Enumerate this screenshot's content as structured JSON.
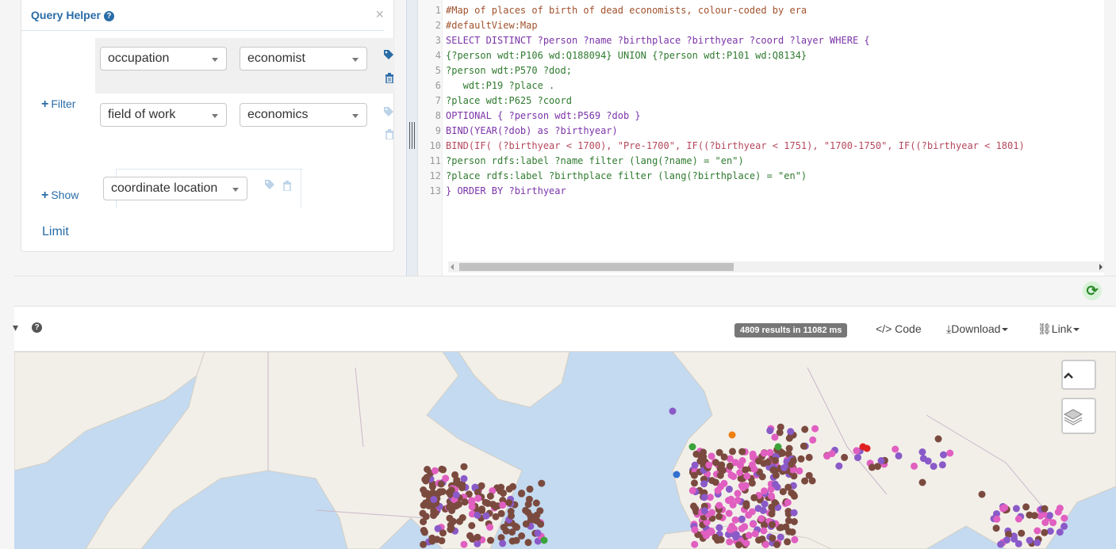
{
  "query_helper": {
    "title": "Query Helper",
    "help_icon": "question-circle-icon",
    "close_label": "×",
    "filter_label": "Filter",
    "show_label": "Show",
    "limit_label": "Limit",
    "filters": [
      {
        "property": "occupation",
        "value": "economist"
      },
      {
        "property": "field of work",
        "value": "economics"
      }
    ],
    "show": {
      "property": "coordinate location"
    }
  },
  "editor": {
    "lines": [
      {
        "n": "1",
        "text": "#Map of places of birth of dead economists, colour-coded by era",
        "kind": "comment"
      },
      {
        "n": "2",
        "text": "#defaultView:Map",
        "kind": "comment"
      },
      {
        "n": "3",
        "text": "SELECT DISTINCT ?person ?name ?birthplace ?birthyear ?coord ?layer WHERE {",
        "kind": "key"
      },
      {
        "n": "4",
        "text": "{?person wdt:P106 wd:Q188094} UNION {?person wdt:P101 wd:Q8134}",
        "kind": "var"
      },
      {
        "n": "5",
        "text": "?person wdt:P570 ?dod;",
        "kind": "var"
      },
      {
        "n": "6",
        "text": "   wdt:P19 ?place .",
        "kind": "var"
      },
      {
        "n": "7",
        "text": "?place wdt:P625 ?coord",
        "kind": "var"
      },
      {
        "n": "8",
        "text": "OPTIONAL { ?person wdt:P569 ?dob }",
        "kind": "key"
      },
      {
        "n": "9",
        "text": "BIND(YEAR(?dob) as ?birthyear)",
        "kind": "key"
      },
      {
        "n": "10",
        "text": "BIND(IF( (?birthyear < 1700), \"Pre-1700\", IF((?birthyear < 1751), \"1700-1750\", IF((?birthyear < 1801)",
        "kind": "code"
      },
      {
        "n": "11",
        "text": "?person rdfs:label ?name filter (lang(?name) = \"en\")",
        "kind": "var"
      },
      {
        "n": "12",
        "text": "?place rdfs:label ?birthplace filter (lang(?birthplace) = \"en\")",
        "kind": "var"
      },
      {
        "n": "13",
        "text": "} ORDER BY ?birthyear",
        "kind": "key"
      }
    ]
  },
  "toolbar": {
    "results": "4809 results in 11082 ms",
    "code_label": "</> Code",
    "download_label": "Download",
    "link_label": "Link",
    "view_caret": "▾",
    "refresh_icon": "refresh-icon"
  },
  "map": {
    "collapse_icon": "chevron-up-icon",
    "layers_icon": "layers-icon",
    "colors": {
      "land": "#f2efe9",
      "water": "#c3daf0",
      "brown": "#7b4a3f",
      "pink": "#e05fc0",
      "purple": "#8a5ac8",
      "green": "#3aa33a",
      "orange": "#f07f12",
      "red": "#e02020",
      "blue": "#2f6fd0"
    }
  }
}
